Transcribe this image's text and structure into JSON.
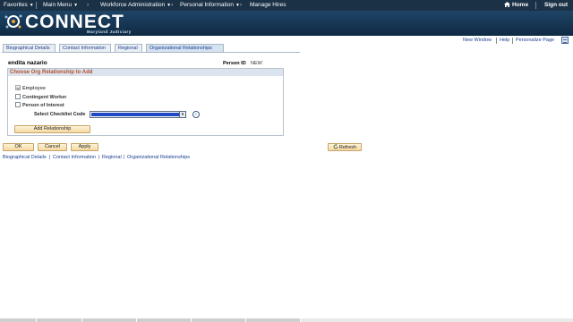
{
  "topnav": {
    "favorites": "Favorites",
    "main_menu": "Main Menu",
    "workforce": "Workforce Administration",
    "personal_info": "Personal Information",
    "manage_hires": "Manage Hires",
    "home": "Home",
    "sign_out": "Sign out",
    "caret": "▼",
    "breadcrumb_sep": "›"
  },
  "banner": {
    "logo_text": "CONNECT",
    "logo_sub": "Maryland Judiciary"
  },
  "util_links": {
    "new_window": "New Window",
    "help": "Help",
    "personalize": "Personalize Page"
  },
  "tabs": [
    {
      "label": "Biographical Details"
    },
    {
      "label": "Contact Information"
    },
    {
      "label": "Regional"
    },
    {
      "label": "Organizational Relationships"
    }
  ],
  "person": {
    "name": "endita nazario",
    "id_label": "Person ID",
    "id_value": "NEW"
  },
  "groupbox": {
    "title": "Choose Org Relationship to Add",
    "checkboxes": [
      {
        "label": "Employee",
        "checked": true,
        "disabled": true
      },
      {
        "label": "Contingent Worker",
        "checked": false,
        "disabled": false
      },
      {
        "label": "Person of Interest",
        "checked": false,
        "disabled": false
      }
    ],
    "checklist_label": "Select Checklist Code",
    "checklist_value": "",
    "add_relationship": "Add Relationship"
  },
  "buttons": {
    "ok": "OK",
    "cancel": "Cancel",
    "apply": "Apply",
    "refresh": "Refresh"
  },
  "bottom_links": [
    "Biographical Details",
    "Contact Information",
    "Regional",
    "Organizational Relationships"
  ],
  "bottom_sep": "|",
  "colors": {
    "nav_bg": "#1b3146",
    "banner_bg": "#0f2a44",
    "link": "#1a3d8f",
    "groupbox_title": "#b2502b",
    "select_highlight": "#1f48c4"
  },
  "icons": {
    "home": "home-icon",
    "refresh": "refresh-icon",
    "dropdown": "chevron-down-icon",
    "lookup": "lookup-circle-icon",
    "grid": "grid-icon"
  }
}
